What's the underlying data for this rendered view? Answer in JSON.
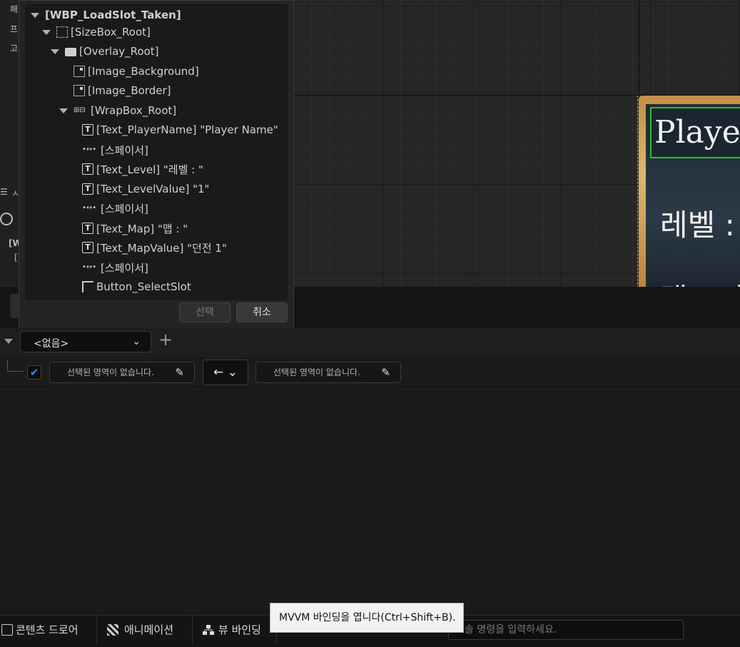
{
  "left_menu": {
    "items": [
      "패",
      "프",
      "고"
    ]
  },
  "left_fragment": {
    "glyph_1": "☰",
    "label_1": "ㅅ",
    "label_2": "[W",
    "label_3": "["
  },
  "tree": {
    "title": "[WBP_LoadSlot_Taken]",
    "nodes": [
      {
        "label": "[SizeBox_Root]"
      },
      {
        "label": "[Overlay_Root]"
      },
      {
        "label": "[Image_Background]"
      },
      {
        "label": "[Image_Border]"
      },
      {
        "label": "[WrapBox_Root]"
      },
      {
        "label": "[Text_PlayerName] \"Player Name\""
      },
      {
        "label": "[스페이서]"
      },
      {
        "label": "[Text_Level] \"레벨 : \""
      },
      {
        "label": "[Text_LevelValue] \"1\""
      },
      {
        "label": "[스페이서]"
      },
      {
        "label": "[Text_Map] \"맵 : \""
      },
      {
        "label": "[Text_MapValue] \"던전 1\""
      },
      {
        "label": "[스페이서]"
      },
      {
        "label": "Button_SelectSlot"
      }
    ],
    "text_icon_glyph": "T",
    "spacer_icon_glyph": "•↔•",
    "wrap_icon_glyph": "⊞⊟"
  },
  "popup_buttons": {
    "select": "선택",
    "cancel": "취소"
  },
  "preview": {
    "name_text": "Player",
    "level_text": "레벨 :",
    "map_text": "맵 : 던"
  },
  "toolbar": {
    "combo_value": "<없음>",
    "combo_chevron": "⌄",
    "add_label": "+"
  },
  "binding": {
    "checked_glyph": "✔",
    "left_field": "선택된 영역이 없습니다.",
    "right_field": "선택된 영역이 없습니다.",
    "edit_glyph": "✎",
    "direction": "← ⌄"
  },
  "bottom_tabs": {
    "content_drawer": "콘텐츠 드로어",
    "animation": "애니메이션",
    "view_binding": "뷰 바인딩"
  },
  "command": {
    "placeholder": "솔 명령을 입력하세요."
  },
  "tooltip": {
    "text": "MVVM 바인딩을 엽니다(Ctrl+Shift+B)."
  },
  "colors": {
    "selection_green": "#28c428",
    "check_blue": "#2b8fff",
    "frame_gold": "#e0b76b"
  }
}
